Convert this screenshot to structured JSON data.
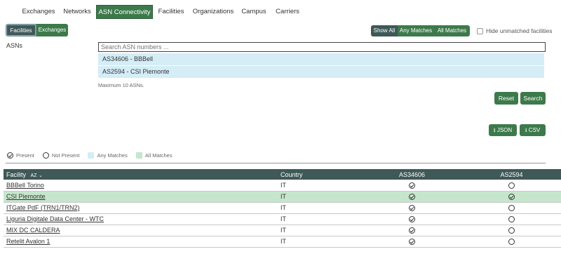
{
  "nav": {
    "tabs": [
      {
        "label": "Exchanges"
      },
      {
        "label": "Networks"
      },
      {
        "label": "ASN Connectivity",
        "active": true
      },
      {
        "label": "Facilities"
      },
      {
        "label": "Organizations"
      },
      {
        "label": "Campus"
      },
      {
        "label": "Carriers"
      }
    ]
  },
  "mode": {
    "facilities": "Facilities",
    "exchanges": "Exchanges"
  },
  "match": {
    "show_all": "Show All",
    "any": "Any Matches",
    "all": "All Matches"
  },
  "hide_unmatched": "Hide unmatched facilities",
  "asn": {
    "label": "ASNs",
    "placeholder": "Search ASN numbers ...",
    "items": [
      "AS34606 - BBBell",
      "AS2594 - CSI Piemonte"
    ],
    "max_note": "Maximum 10 ASNs."
  },
  "buttons": {
    "reset": "Reset",
    "search": "Search",
    "json": "JSON",
    "csv": "CSV"
  },
  "legend": {
    "present": "Present",
    "not_present": "Not Present",
    "any": "Any Matches",
    "all": "All Matches",
    "any_color": "#d4edf7",
    "all_color": "#c6e6cc"
  },
  "table": {
    "headers": {
      "facility": "Facility",
      "sort": "AZ",
      "country": "Country",
      "asn1": "AS34606",
      "asn2": "AS2594"
    },
    "rows": [
      {
        "facility": "BBBell Torino",
        "country": "IT",
        "a1": true,
        "a2": false,
        "highlight": false
      },
      {
        "facility": "CSI Piemonte",
        "country": "IT",
        "a1": true,
        "a2": true,
        "highlight": true
      },
      {
        "facility": "ITGate PdF (TRN1/TRN2)",
        "country": "IT",
        "a1": true,
        "a2": false,
        "highlight": false
      },
      {
        "facility": "Liguria Digitale Data Center - WTC",
        "country": "IT",
        "a1": true,
        "a2": false,
        "highlight": false
      },
      {
        "facility": "MIX DC CALDERA",
        "country": "IT",
        "a1": true,
        "a2": false,
        "highlight": false
      },
      {
        "facility": "Retelit Avalon 1",
        "country": "IT",
        "a1": true,
        "a2": false,
        "highlight": false
      }
    ]
  }
}
